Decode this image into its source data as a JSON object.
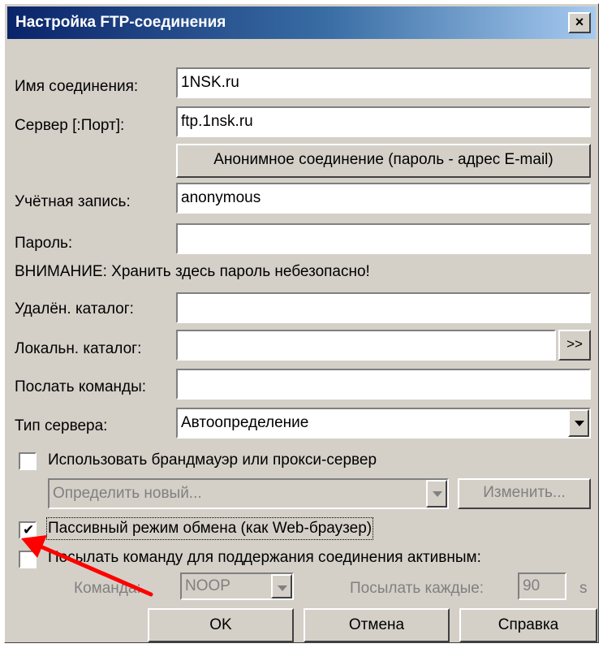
{
  "window": {
    "title": "Настройка FTP-соединения",
    "close_glyph": "×"
  },
  "fields": {
    "connection_name": {
      "label": "Имя соединения:",
      "value": "1NSK.ru"
    },
    "server": {
      "label": "Сервер [:Порт]:",
      "value": "ftp.1nsk.ru"
    },
    "anonymous_button": "Анонимное соединение (пароль - адрес E-mail)",
    "account": {
      "label": "Учётная запись:",
      "value": "anonymous"
    },
    "password": {
      "label": "Пароль:",
      "value": ""
    },
    "warning": "ВНИМАНИЕ: Хранить здесь пароль небезопасно!",
    "remote_dir": {
      "label": "Удалён. каталог:",
      "value": ""
    },
    "local_dir": {
      "label": "Локальн. каталог:",
      "value": "",
      "browse": ">>"
    },
    "send_commands": {
      "label": "Послать команды:",
      "value": ""
    },
    "server_type": {
      "label": "Тип сервера:",
      "value": "Автоопределение"
    }
  },
  "firewall": {
    "checkbox_label": "Использовать брандмауэр или прокси-сервер",
    "checked": false,
    "select_value": "Определить новый...",
    "change_button": "Изменить..."
  },
  "passive": {
    "checkbox_label": "Пассивный режим обмена (как Web-браузер)",
    "checked": true
  },
  "keepalive": {
    "checkbox_label": "Посылать команду для поддержания соединения активным:",
    "checked": false,
    "command_label": "Команда:",
    "command_value": "NOOP",
    "interval_label": "Посылать каждые:",
    "interval_value": "90",
    "interval_unit": "s"
  },
  "buttons": {
    "ok": "OK",
    "cancel": "Отмена",
    "help": "Справка"
  },
  "annotation": {
    "arrow_color": "#ff0000"
  }
}
